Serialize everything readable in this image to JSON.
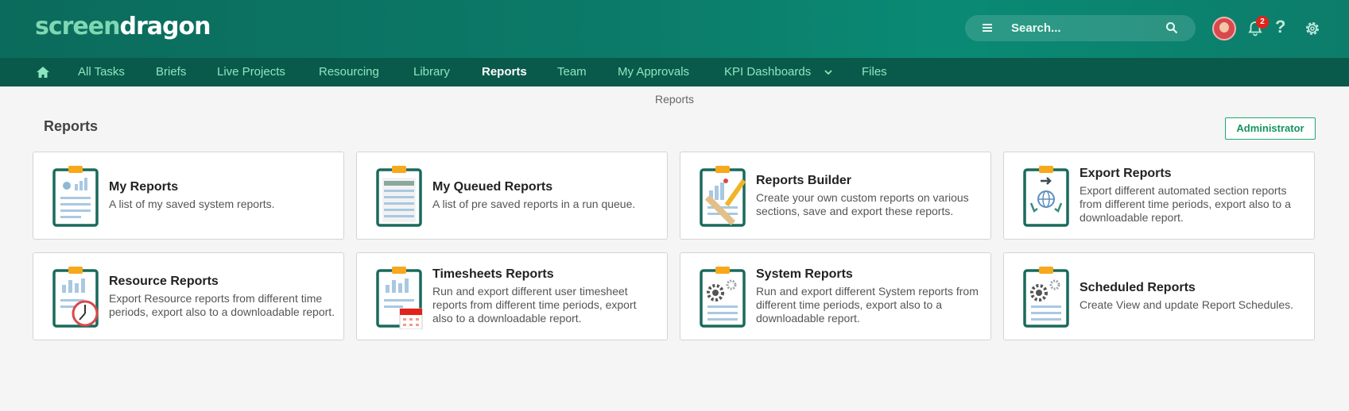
{
  "header": {
    "logo_part1": "screen",
    "logo_part2": "dragon",
    "search_placeholder": "Search...",
    "notification_count": "2",
    "help_label": "?"
  },
  "nav": {
    "items": [
      {
        "label": "All Tasks"
      },
      {
        "label": "Briefs"
      },
      {
        "label": "Live Projects"
      },
      {
        "label": "Resourcing"
      },
      {
        "label": "Library"
      },
      {
        "label": "Reports",
        "active": true
      },
      {
        "label": "Team"
      },
      {
        "label": "My Approvals"
      },
      {
        "label": "KPI Dashboards"
      },
      {
        "label": "Files"
      }
    ]
  },
  "breadcrumb": "Reports",
  "page": {
    "title": "Reports",
    "admin_button": "Administrator"
  },
  "cards": [
    {
      "title": "My Reports",
      "desc": "A list of my saved system reports.",
      "icon": "clipboard-chart-icon"
    },
    {
      "title": "My Queued Reports",
      "desc": "A list of pre saved reports in a run queue.",
      "icon": "clipboard-list-icon"
    },
    {
      "title": "Reports Builder",
      "desc": "Create your own custom reports on various sections, save and export these reports.",
      "icon": "clipboard-pencil-icon"
    },
    {
      "title": "Export Reports",
      "desc": "Export different automated section reports from different time periods, export also to a downloadable report.",
      "icon": "clipboard-globe-icon"
    },
    {
      "title": "Resource Reports",
      "desc": "Export Resource reports from different time periods, export also to a downloadable report.",
      "icon": "clipboard-clock-icon"
    },
    {
      "title": "Timesheets Reports",
      "desc": "Run and export different user timesheet reports from different time periods, export also to a downloadable report.",
      "icon": "clipboard-calendar-icon"
    },
    {
      "title": "System Reports",
      "desc": "Run and export different System reports from different time periods, export also to a downloadable report.",
      "icon": "clipboard-gears-icon"
    },
    {
      "title": "Scheduled Reports",
      "desc": "Create View and update Report Schedules.",
      "icon": "clipboard-gears-icon"
    }
  ],
  "colors": {
    "header_bg": "#0c7a68",
    "nav_bg": "#0a5a4c",
    "nav_text": "#8be6bd",
    "accent": "#14955f"
  }
}
